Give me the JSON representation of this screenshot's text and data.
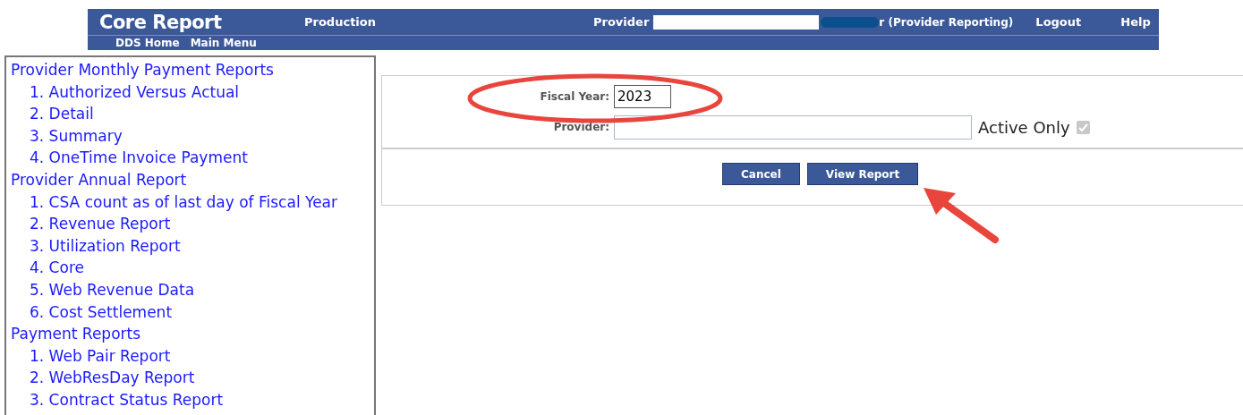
{
  "header": {
    "title": "Core Report",
    "environment": "Production",
    "provider_label": "Provider",
    "user_suffix": "r (Provider Reporting)",
    "links": [
      "Logout",
      "Help"
    ],
    "nav": [
      "DDS Home",
      "Main Menu"
    ]
  },
  "sidebar": {
    "groups": [
      {
        "title": "Provider Monthly Payment Reports",
        "items": [
          "1. Authorized Versus Actual",
          "2. Detail",
          "3. Summary",
          "4. OneTime Invoice Payment"
        ]
      },
      {
        "title": "Provider Annual Report",
        "items": [
          "1. CSA count as of last day of Fiscal Year",
          "2. Revenue Report",
          "3. Utilization Report",
          "4. Core",
          "5. Web Revenue Data",
          "6. Cost Settlement"
        ]
      },
      {
        "title": "Payment Reports",
        "items": [
          "1. Web Pair Report",
          "2. WebResDay Report",
          "3. Contract Status Report"
        ]
      }
    ]
  },
  "form": {
    "fiscal_year_label": "Fiscal Year:",
    "fiscal_year": "2023",
    "provider_label": "Provider:",
    "active_only_label": "Active Only",
    "active_only": {
      "checked": true,
      "disabled": true
    },
    "buttons": [
      "Cancel",
      "View Report"
    ]
  }
}
